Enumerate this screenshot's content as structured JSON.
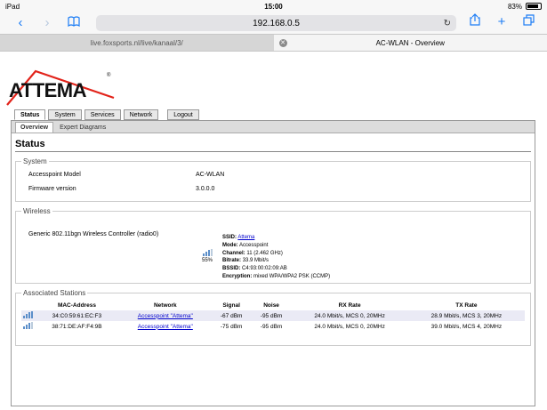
{
  "status_bar": {
    "device": "iPad",
    "time": "15:00",
    "battery": "83%"
  },
  "browser": {
    "url": "192.168.0.5",
    "tabs": [
      {
        "label": "live.foxsports.nl/live/kanaal/3/",
        "active": false
      },
      {
        "label": "AC-WLAN - Overview",
        "active": true
      }
    ]
  },
  "logo": {
    "text": "ATTEMA",
    "mark": "®"
  },
  "nav": {
    "tabs": [
      "Status",
      "System",
      "Services",
      "Network"
    ],
    "logout": "Logout",
    "subtabs": [
      "Overview",
      "Expert Diagrams"
    ]
  },
  "page": {
    "title": "Status",
    "system": {
      "legend": "System",
      "rows": [
        {
          "key": "Accesspoint Model",
          "value": "AC-WLAN"
        },
        {
          "key": "Firmware version",
          "value": "3.0.0.0"
        }
      ]
    },
    "wireless": {
      "legend": "Wireless",
      "controller": "Generic 802.11bgn Wireless Controller (radio0)",
      "signal_percent": "55%",
      "info": [
        {
          "key": "SSID:",
          "value": "Attema",
          "link": true
        },
        {
          "key": "Mode:",
          "value": "Accesspoint"
        },
        {
          "key": "Channel:",
          "value": "11 (2.462 GHz)"
        },
        {
          "key": "Bitrate:",
          "value": "33.9 Mbit/s"
        },
        {
          "key": "BSSID:",
          "value": "C4:93:00:02:09:AB"
        },
        {
          "key": "Encryption:",
          "value": "mixed WPA/WPA2 PSK (CCMP)"
        }
      ]
    },
    "stations": {
      "legend": "Associated Stations",
      "headers": [
        "MAC-Address",
        "Network",
        "Signal",
        "Noise",
        "RX Rate",
        "TX Rate"
      ],
      "rows": [
        {
          "mac": "34:C0:59:61:EC:F3",
          "network": "Accesspoint \"Attema\"",
          "signal": "-67 dBm",
          "noise": "-95 dBm",
          "rx": "24.0 Mbit/s, MCS 0, 20MHz",
          "tx": "28.9 Mbit/s, MCS 3, 20MHz"
        },
        {
          "mac": "38:71:DE:AF:F4:9B",
          "network": "Accesspoint \"Attema\"",
          "signal": "-75 dBm",
          "noise": "-95 dBm",
          "rx": "24.0 Mbit/s, MCS 0, 20MHz",
          "tx": "39.0 Mbit/s, MCS 4, 20MHz"
        }
      ]
    }
  },
  "colors": {
    "ios_blue": "#1b7cf5",
    "logo_red": "#e2231a",
    "table_stripe": "#eaeaf5"
  }
}
